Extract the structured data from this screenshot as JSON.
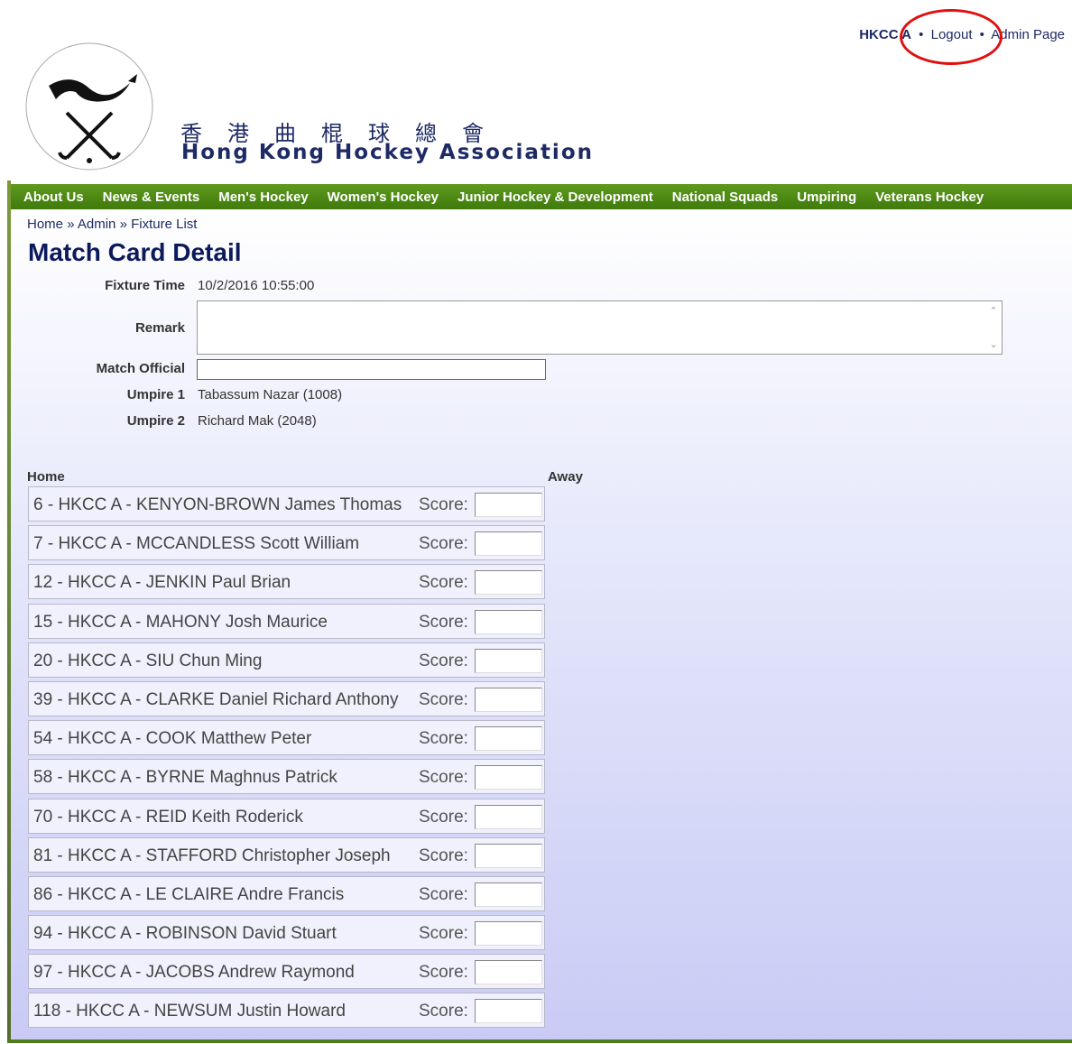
{
  "header": {
    "title_cn": "香港曲棍球總會",
    "title_en": "Hong Kong Hockey Association",
    "user": "HKCC A",
    "logout": "Logout",
    "admin": "Admin Page",
    "separator": "•",
    "highlight_color": "#e01010"
  },
  "menu": {
    "items": [
      "About Us",
      "News & Events",
      "Men's Hockey",
      "Women's Hockey",
      "Junior Hockey & Development",
      "National Squads",
      "Umpiring",
      "Veterans Hockey"
    ],
    "color": "#4e8a14"
  },
  "breadcrumb": {
    "home": "Home",
    "admin": "Admin",
    "fixture_list": "Fixture List",
    "sep": "»"
  },
  "page_title": "Match Card Detail",
  "form": {
    "fixture_time_label": "Fixture Time",
    "fixture_time": "10/2/2016 10:55:00",
    "remark_label": "Remark",
    "remark_value": "",
    "match_official_label": "Match Official",
    "match_official_value": "",
    "umpire1_label": "Umpire 1",
    "umpire1": "Tabassum Nazar (1008)",
    "umpire2_label": "Umpire 2",
    "umpire2": "Richard Mak (2048)"
  },
  "teams": {
    "home_label": "Home",
    "away_label": "Away"
  },
  "score_label": "Score:",
  "players": [
    "6 - HKCC A - KENYON-BROWN James Thomas",
    "7 - HKCC A - MCCANDLESS Scott William",
    "12 - HKCC A - JENKIN Paul Brian",
    "15 - HKCC A - MAHONY Josh Maurice",
    "20 - HKCC A - SIU Chun Ming",
    "39 - HKCC A - CLARKE Daniel Richard Anthony",
    "54 - HKCC A - COOK Matthew Peter",
    "58 - HKCC A - BYRNE Maghnus Patrick",
    "70 - HKCC A - REID Keith Roderick",
    "81 - HKCC A - STAFFORD Christopher Joseph",
    "86 - HKCC A - LE CLAIRE Andre Francis",
    "94 - HKCC A - ROBINSON David Stuart",
    "97 - HKCC A - JACOBS Andrew Raymond",
    "118 - HKCC A - NEWSUM Justin Howard"
  ]
}
